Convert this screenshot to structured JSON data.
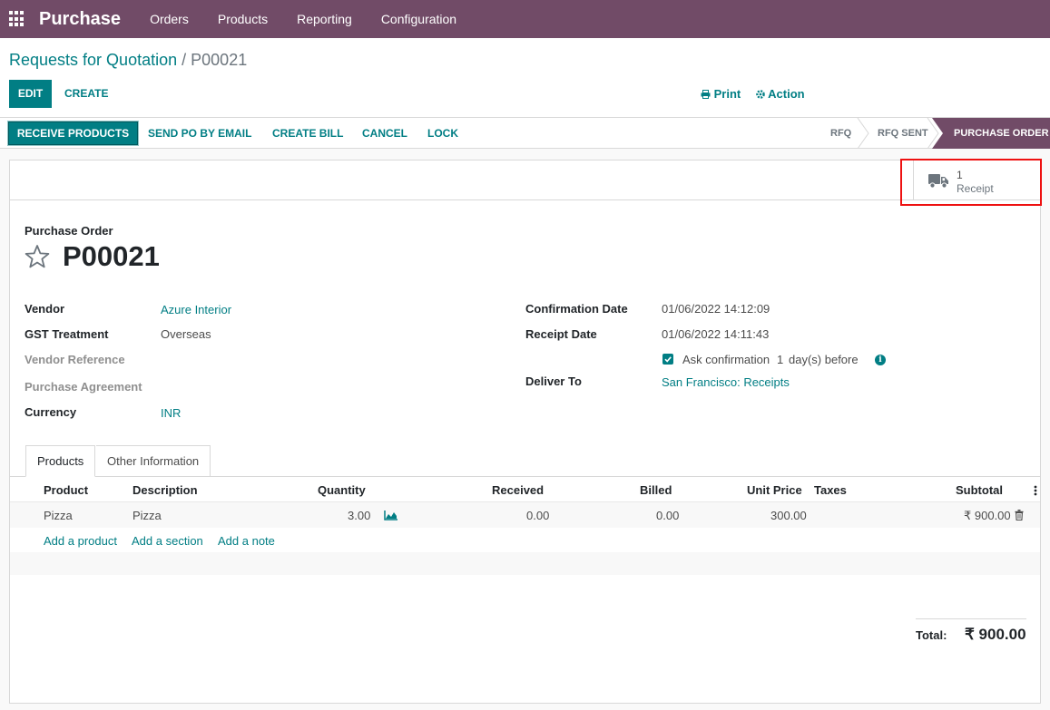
{
  "nav": {
    "app_name": "Purchase",
    "menu": [
      "Orders",
      "Products",
      "Reporting",
      "Configuration"
    ]
  },
  "breadcrumb": {
    "parent": "Requests for Quotation",
    "separator": "/",
    "current": "P00021"
  },
  "toolbar": {
    "edit_label": "EDIT",
    "create_label": "CREATE",
    "print_label": "Print",
    "action_label": "Action"
  },
  "statusbar": {
    "buttons": [
      "RECEIVE PRODUCTS",
      "SEND PO BY EMAIL",
      "CREATE BILL",
      "CANCEL",
      "LOCK"
    ],
    "stages": [
      "RFQ",
      "RFQ SENT",
      "PURCHASE ORDER"
    ],
    "active_stage": "PURCHASE ORDER"
  },
  "smart_button": {
    "count": "1",
    "label": "Receipt",
    "icon": "truck-icon"
  },
  "order": {
    "doc_type": "Purchase Order",
    "name": "P00021",
    "favorite_icon": "star-icon"
  },
  "fields": {
    "vendor_label": "Vendor",
    "vendor_value": "Azure Interior",
    "gst_label": "GST Treatment",
    "gst_value": "Overseas",
    "vendor_ref_label": "Vendor Reference",
    "agreement_label": "Purchase Agreement",
    "currency_label": "Currency",
    "currency_value": "INR",
    "confirmation_label": "Confirmation Date",
    "confirmation_value": "01/06/2022 14:12:09",
    "receipt_label": "Receipt Date",
    "receipt_value": "01/06/2022 14:11:43",
    "ask_confirmation": "Ask confirmation",
    "ask_days": "1",
    "ask_suffix": "day(s) before",
    "deliver_label": "Deliver To",
    "deliver_value": "San Francisco: Receipts"
  },
  "tabs": [
    "Products",
    "Other Information"
  ],
  "table": {
    "columns": [
      "Product",
      "Description",
      "Quantity",
      "Received",
      "Billed",
      "Unit Price",
      "Taxes",
      "Subtotal"
    ],
    "rows": [
      {
        "product": "Pizza",
        "description": "Pizza",
        "quantity": "3.00",
        "received": "0.00",
        "billed": "0.00",
        "unit_price": "300.00",
        "taxes": "",
        "subtotal": "₹ 900.00"
      }
    ],
    "add_links": [
      "Add a product",
      "Add a section",
      "Add a note"
    ]
  },
  "totals": {
    "label": "Total:",
    "value": "₹ 900.00"
  },
  "colors": {
    "brand": "#714b67",
    "accent": "#017e84",
    "highlight": "#e11111"
  }
}
